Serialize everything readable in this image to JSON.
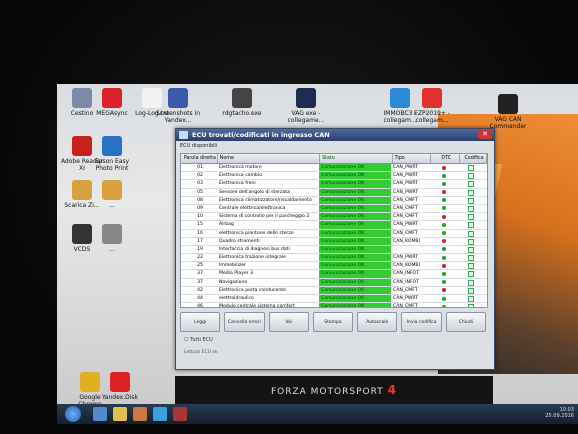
{
  "desktop": {
    "icons": [
      {
        "label": "Cestino",
        "color": "#7a8aa8"
      },
      {
        "label": "MEGAsync",
        "color": "#d9222a"
      },
      {
        "label": "Log-Log.txt",
        "color": "#f2f2f2"
      },
      {
        "label": "Screenshots in Yandex...",
        "color": "#3c5aa8"
      },
      {
        "label": "rdgtacho.exe",
        "color": "#444"
      },
      {
        "label": "VAG exe - collegame...",
        "color": "#1f2c52"
      },
      {
        "label": "IMMOBC3 - collegam...",
        "color": "#2a8ad8"
      },
      {
        "label": "EZP2019+ - collegam...",
        "color": "#e03030"
      },
      {
        "label": "VAG CAN Commander",
        "color": "#222"
      },
      {
        "label": "Adobe Reader XI",
        "color": "#c81f1f"
      },
      {
        "label": "Epson Easy Photo Print",
        "color": "#2a6fc8"
      },
      {
        "label": "Scarica Zi...",
        "color": "#d9a040"
      },
      {
        "label": "...",
        "color": "#d9a040"
      },
      {
        "label": "VCDS",
        "color": "#333"
      },
      {
        "label": "...",
        "color": "#888"
      },
      {
        "label": "Google Chrome",
        "color": "#e0b020"
      },
      {
        "label": "Yandex.Disk",
        "color": "#d22"
      }
    ]
  },
  "ecu_window": {
    "title": "ECU trovati/codificati in ingresso CAN",
    "group_label": "ECU disponibili",
    "columns": [
      "Parola diretta",
      "Nome",
      "Stato",
      "Tipo",
      "DTC",
      "Codifica"
    ],
    "rows": [
      {
        "code": "01",
        "name": "Elettronica motore",
        "stato": "Comunicazione OK",
        "tipo": "CAN_PWRT"
      },
      {
        "code": "02",
        "name": "Elettronica cambio",
        "stato": "Comunicazione OK",
        "tipo": "CAN_PWRT"
      },
      {
        "code": "03",
        "name": "Elettronica freni",
        "stato": "Comunicazione OK",
        "tipo": "CAN_PWRT"
      },
      {
        "code": "05",
        "name": "Sensore dell'angolo di sterzata",
        "stato": "Comunicazione OK",
        "tipo": "CAN_PWRT"
      },
      {
        "code": "08",
        "name": "Elettronica climatizzatore/riscaldamento",
        "stato": "Comunicazione OK",
        "tipo": "CAN_CMFT"
      },
      {
        "code": "09",
        "name": "Centrale elettrica/elettronica",
        "stato": "Comunicazione OK",
        "tipo": "CAN_CMFT"
      },
      {
        "code": "10",
        "name": "Sistema di controllo per il parcheggio 2",
        "stato": "Comunicazione OK",
        "tipo": "CAN_CMFT"
      },
      {
        "code": "15",
        "name": "Airbag",
        "stato": "Comunicazione OK",
        "tipo": "CAN_PWRT"
      },
      {
        "code": "16",
        "name": "elettronica piantone dello sterzo",
        "stato": "Comunicazione OK",
        "tipo": "CAN_CMFT"
      },
      {
        "code": "17",
        "name": "Quadro strumenti",
        "stato": "Comunicazione OK",
        "tipo": "CAN_KOMBI"
      },
      {
        "code": "19",
        "name": "Interfaccia di diagnosi bus dati",
        "stato": "Comunicazione OK",
        "tipo": ""
      },
      {
        "code": "22",
        "name": "Elettronica trazione integrale",
        "stato": "Comunicazione OK",
        "tipo": "CAN_PWRT"
      },
      {
        "code": "25",
        "name": "Immobilizer",
        "stato": "Comunicazione OK",
        "tipo": "CAN_KOMBI"
      },
      {
        "code": "37",
        "name": "Media Player 3",
        "stato": "Comunicazione OK",
        "tipo": "CAN_INFOT"
      },
      {
        "code": "37",
        "name": "Navigazione",
        "stato": "Comunicazione OK",
        "tipo": "CAN_INFOT"
      },
      {
        "code": "42",
        "name": "Elettronica porta conducente",
        "stato": "Comunicazione OK",
        "tipo": "CAN_CMFT"
      },
      {
        "code": "44",
        "name": "elettroidraulico",
        "stato": "Comunicazione OK",
        "tipo": "CAN_PWRT"
      },
      {
        "code": "46",
        "name": "Modulo centrale sistema comfort",
        "stato": "Comunicazione OK",
        "tipo": "CAN_CMFT"
      },
      {
        "code": "47",
        "name": "Sound system",
        "stato": "Comunicazione OK",
        "tipo": "CAN_INFOT"
      },
      {
        "code": "4C",
        "name": "Controllo pressione pneumatici 2",
        "stato": "Comunicazione OK",
        "tipo": "CAN_PWRT"
      },
      {
        "code": "4F",
        "name": "Centrale elettrica/elettronica 2",
        "stato": "Comunicazione OK",
        "tipo": "CAN_CMFT"
      }
    ],
    "buttons": [
      "Leggi",
      "Cancella errori",
      "Vai",
      "Stampa",
      "Autoscale",
      "Invia codifica",
      "Chiudi"
    ],
    "tutti_label": "Tutti ECU",
    "status_label": "Lettura ECU ok"
  },
  "banner": {
    "text": "FORZA MOTORSPORT",
    "num": "4"
  },
  "taskbar": {
    "clock_time": "10:03",
    "clock_date": "25.09.2016"
  },
  "colors": {
    "status_ok": "#33cc33",
    "title_bar": "#2c3f6b",
    "dtc_red": "#d82020",
    "dtc_green": "#1fa81f"
  }
}
